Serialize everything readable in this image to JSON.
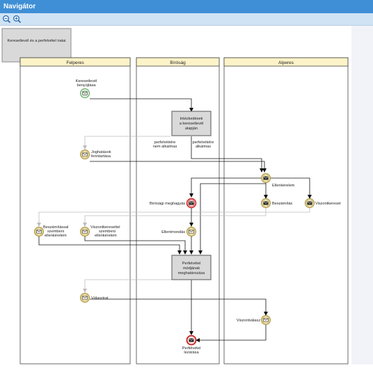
{
  "app": {
    "title": "Navigátor"
  },
  "toolbar": {
    "zoom_out_icon": "zoom-out-icon",
    "zoom_in_icon": "zoom-in-icon"
  },
  "diagram": {
    "header_task": "Keresetlevél és a perfelvétel iratai",
    "lanes": {
      "felperes": "Felperes",
      "birosag": "Bíróság",
      "alperes": "Alperes"
    },
    "tasks": {
      "intezkedes": [
        "Intézkedések",
        "a keresetlevél",
        "alapján"
      ],
      "perfelvetel": [
        "Perfelvétel",
        "módjának",
        "meghatározása"
      ]
    },
    "events": {
      "start": [
        "Keresetlevél",
        "benyújtása"
      ],
      "joghatasok": [
        "Joghatások",
        "fenntartása"
      ],
      "ellenkerelem": "Ellenkérelem",
      "birosagi_meghagyas": "Bírósági meghagyás",
      "beszamitas": "Beszámítás",
      "viszontkereset": "Viszontkereset",
      "beszamitassal": [
        "Beszámítással",
        "szembeni",
        "ellenkérelem"
      ],
      "viszontkeresettel": [
        "Viszontkeresettel",
        "szembeni",
        "ellenkérelem"
      ],
      "ellentmondas": "Ellentmondás",
      "valaszirat": "Válaszirat",
      "viszontvalasz": "Viszontválasz",
      "end": [
        "Perfelvétel",
        "lezárása"
      ]
    },
    "flow_labels": {
      "nem_alkalmas": [
        "perfelvételre",
        "nem alkalmas"
      ],
      "alkalmas": [
        "perfelvételre",
        "alkalmas"
      ]
    }
  }
}
